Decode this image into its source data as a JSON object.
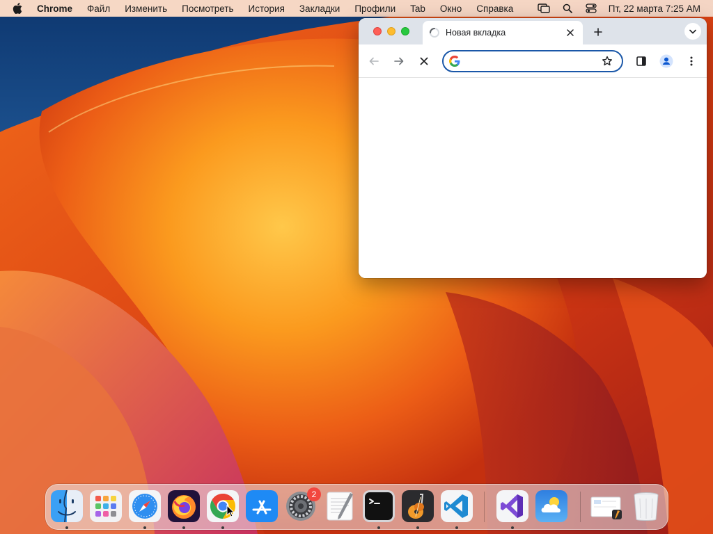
{
  "menubar": {
    "app_name": "Chrome",
    "items": [
      "Файл",
      "Изменить",
      "Посмотреть",
      "История",
      "Закладки",
      "Профили",
      "Tab",
      "Окно",
      "Справка"
    ],
    "clock": "Пт, 22 марта  7:25 AM",
    "status_icons": [
      "screen-mirroring-icon",
      "spotlight-search-icon",
      "control-center-icon"
    ]
  },
  "browser": {
    "tab_title": "Новая вкладка",
    "tab_state": "loading",
    "omnibox_value": "",
    "omnibox_focused": true,
    "accent_color": "#1a57a8",
    "tabstrip_color": "#dee3ea"
  },
  "dock": {
    "apps": [
      {
        "name": "finder",
        "running": true
      },
      {
        "name": "launchpad",
        "running": false
      },
      {
        "name": "safari",
        "running": true
      },
      {
        "name": "firefox",
        "running": true
      },
      {
        "name": "chrome",
        "running": true
      },
      {
        "name": "app-store",
        "running": false
      },
      {
        "name": "system-settings",
        "running": false,
        "badge": "2"
      },
      {
        "name": "textedit",
        "running": false
      },
      {
        "name": "terminal",
        "running": true
      },
      {
        "name": "garageband",
        "running": true
      },
      {
        "name": "vscode",
        "running": true
      },
      {
        "name": "visual-studio",
        "running": true
      },
      {
        "name": "weather",
        "running": false
      },
      {
        "name": "recent-document",
        "running": false
      },
      {
        "name": "trash",
        "running": false
      }
    ]
  }
}
